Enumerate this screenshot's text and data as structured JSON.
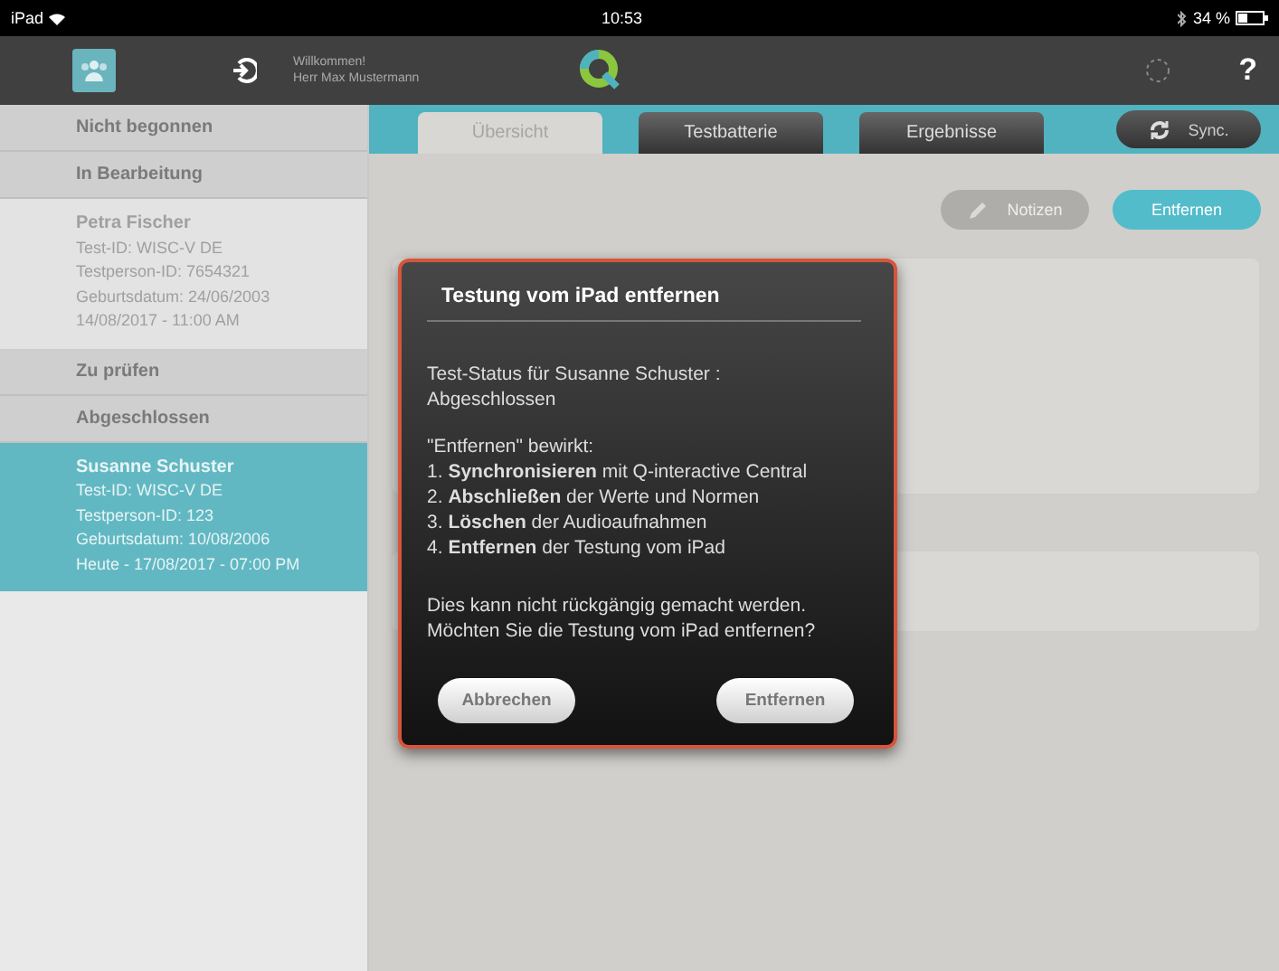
{
  "status_bar": {
    "carrier": "iPad",
    "time": "10:53",
    "battery": "34 %"
  },
  "header": {
    "welcome": "Willkommen!",
    "user": "Herr Max Mustermann",
    "help": "?"
  },
  "sidebar": {
    "sections": [
      {
        "title": "Nicht begonnen"
      },
      {
        "title": "In Bearbeitung",
        "tests": [
          {
            "name": "Petra Fischer",
            "selected": false,
            "lines": [
              "Test-ID: WISC-V DE",
              "Testperson-ID: 7654321",
              "Geburtsdatum: 24/06/2003",
              "14/08/2017 - 11:00 AM"
            ]
          }
        ]
      },
      {
        "title": "Zu prüfen"
      },
      {
        "title": "Abgeschlossen",
        "tests": [
          {
            "name": "Susanne Schuster",
            "selected": true,
            "lines": [
              "Test-ID: WISC-V DE",
              "Testperson-ID: 123",
              "Geburtsdatum: 10/08/2006",
              "Heute - 17/08/2017 - 07:00 PM"
            ]
          }
        ]
      }
    ]
  },
  "tabs": [
    {
      "label": "Übersicht",
      "selected": true
    },
    {
      "label": "Testbatterie",
      "selected": false
    },
    {
      "label": "Ergebnisse",
      "selected": false
    }
  ],
  "sync_button": "Sync.",
  "actions": {
    "notes": {
      "label": "Notizen",
      "disabled": true
    },
    "remove": {
      "label": "Entfernen",
      "disabled": false
    }
  },
  "dialog": {
    "title": "Testung vom iPad entfernen",
    "status": "Test-Status für Susanne Schuster : Abgeschlossen",
    "effects_heading": "\"Entfernen\" bewirkt:",
    "steps": [
      "1. **Synchronisieren** mit Q-interactive Central",
      "2. **Abschließen** der Werte und Normen",
      "3. **Löschen** der Audioaufnahmen",
      "4. **Entfernen** der Testung vom iPad"
    ],
    "warning": [
      "Dies kann nicht rückgängig gemacht werden.",
      "Möchten Sie die Testung vom iPad entfernen?"
    ],
    "buttons": [
      "Abbrechen",
      "Entfernen"
    ]
  }
}
